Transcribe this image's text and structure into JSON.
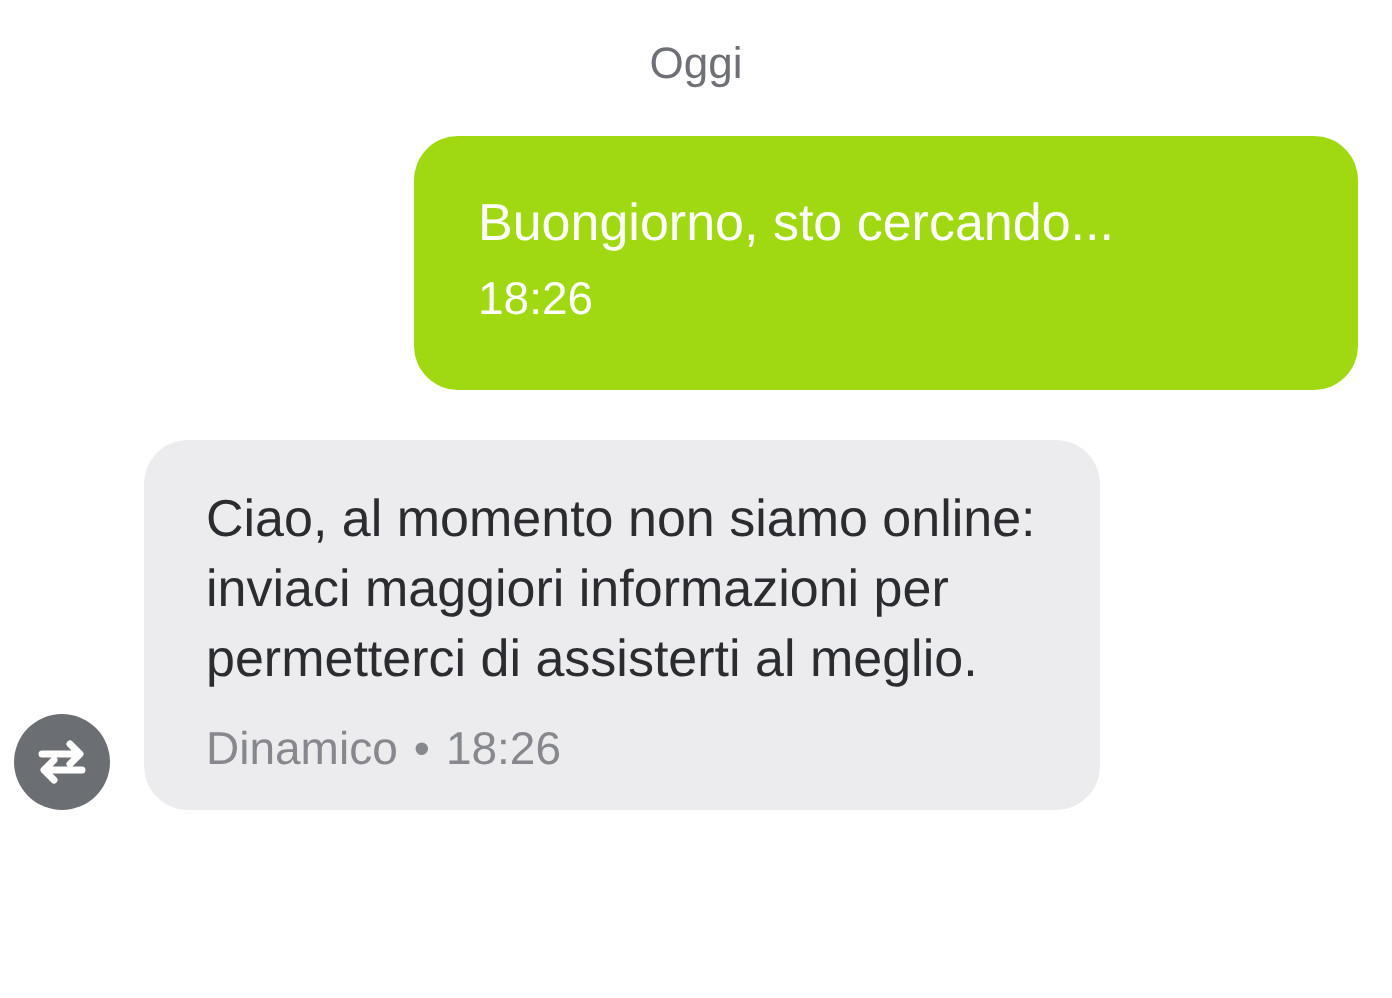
{
  "date_separator": "Oggi",
  "messages": [
    {
      "kind": "sent",
      "text": "Buongiorno, sto cercando...",
      "time": "18:26"
    },
    {
      "kind": "received",
      "text": "Ciao, al momento non siamo online: inviaci maggiori informazioni per permetterci di assisterti al meglio.",
      "sender": "Dinamico",
      "separator": "•",
      "time": "18:26"
    }
  ]
}
